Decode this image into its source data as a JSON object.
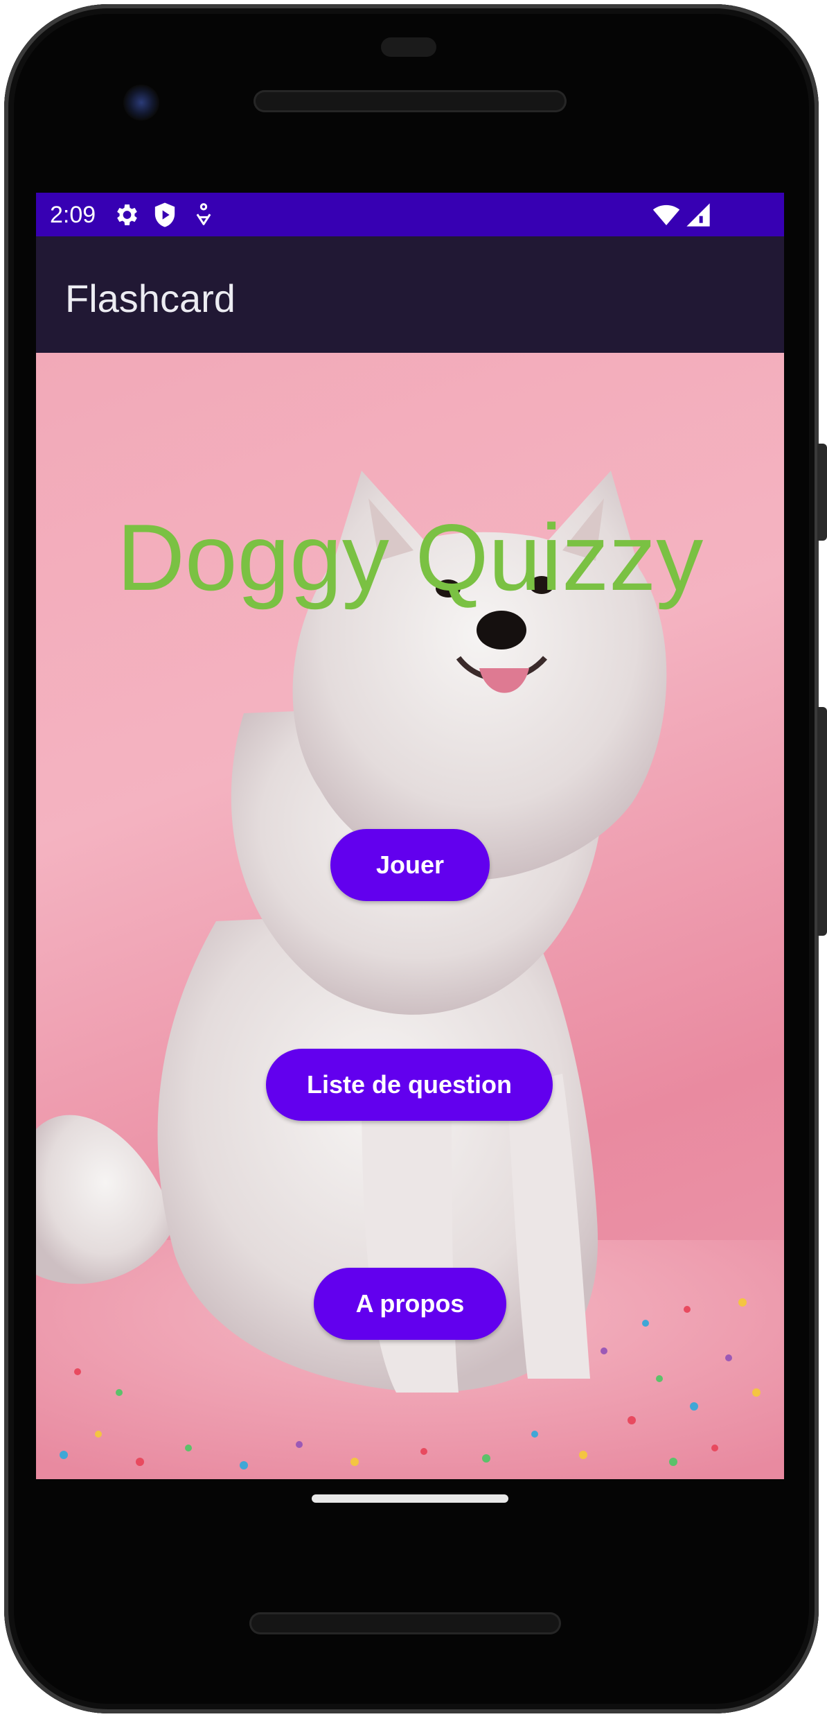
{
  "status_bar": {
    "time": "2:09",
    "icons_left": [
      "gear-icon",
      "shield-icon",
      "accessibility-icon"
    ],
    "icons_right": [
      "wifi-icon",
      "cell-signal-icon"
    ],
    "color": "#3700b3"
  },
  "app_bar": {
    "title": "Flashcard",
    "color": "#211834"
  },
  "main": {
    "headline": "Doggy Quizzy",
    "headline_color": "#7ac143",
    "background_image": "samoyed-dog-on-pink-background-with-confetti",
    "buttons": {
      "play": "Jouer",
      "question_list": "Liste de question",
      "about": "A propos"
    },
    "button_color": "#6200ee"
  }
}
